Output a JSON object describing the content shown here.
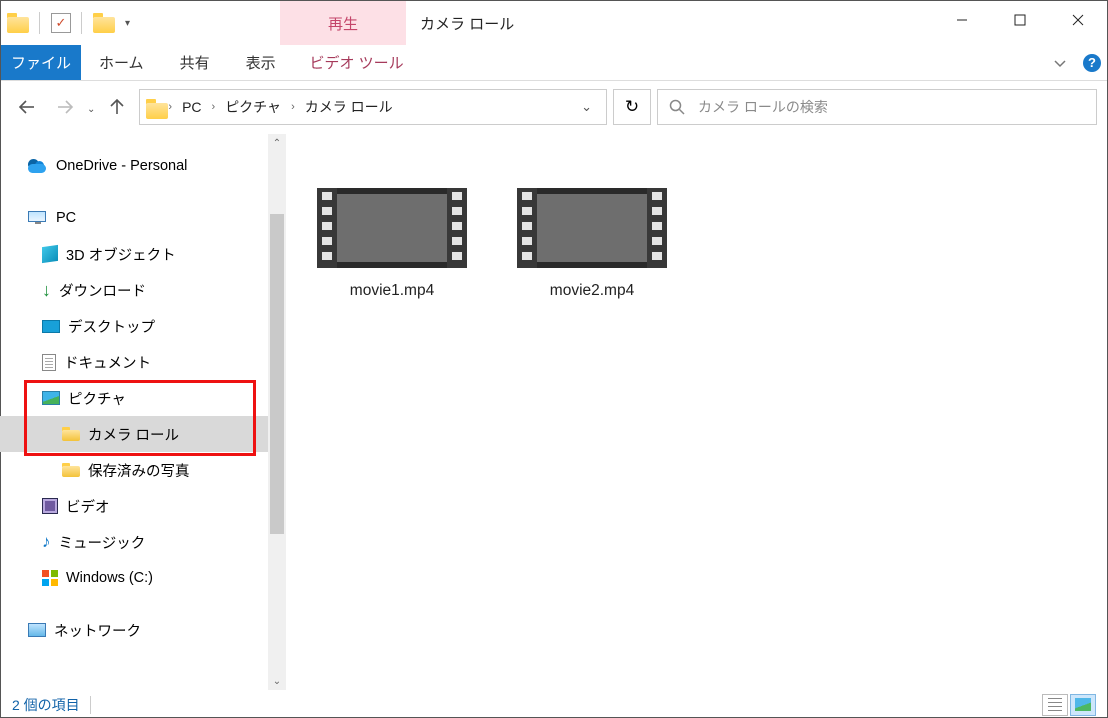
{
  "titlebar": {
    "contextual_tab_title": "再生",
    "window_title": "カメラ ロール"
  },
  "ribbon": {
    "file": "ファイル",
    "tabs": [
      "ホーム",
      "共有",
      "表示"
    ],
    "contextual_tab": "ビデオ ツール"
  },
  "navbar": {
    "breadcrumb": [
      "PC",
      "ピクチャ",
      "カメラ ロール"
    ],
    "search_placeholder": "カメラ ロールの検索",
    "refresh_glyph": "↻"
  },
  "tree": {
    "onedrive": "OneDrive - Personal",
    "pc": "PC",
    "children": [
      "3D オブジェクト",
      "ダウンロード",
      "デスクトップ",
      "ドキュメント",
      "ピクチャ"
    ],
    "pictures_children": [
      "カメラ ロール",
      "保存済みの写真"
    ],
    "after_pictures": [
      "ビデオ",
      "ミュージック",
      "Windows (C:)"
    ],
    "network": "ネットワーク"
  },
  "files": [
    {
      "name": "movie1.mp4"
    },
    {
      "name": "movie2.mp4"
    }
  ],
  "statusbar": {
    "count_text": "2 個の項目"
  }
}
